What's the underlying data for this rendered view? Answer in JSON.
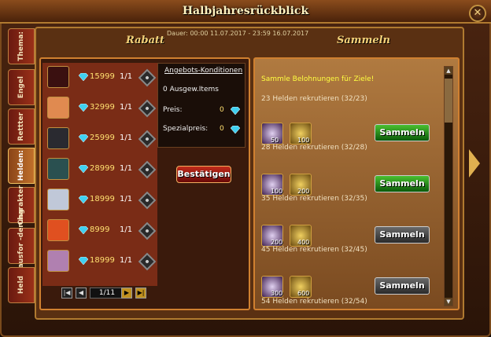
{
  "window": {
    "title": "Halbjahresrückblick",
    "close": "✕"
  },
  "tabs": [
    "Thema:",
    "Engel",
    "Rettter",
    "Helden:",
    "Charakter",
    "Herausfor -derung",
    "Held"
  ],
  "headers": {
    "left": "Rabatt",
    "right": "Sammeln",
    "dauer": "Dauer: 00:00 11.07.2017 - 23:59 16.07.2017"
  },
  "offers": [
    {
      "price": "15999",
      "qty": "1/1",
      "color": "#3a1010"
    },
    {
      "price": "32999",
      "qty": "1/1",
      "color": "#e08a50"
    },
    {
      "price": "25999",
      "qty": "1/1",
      "color": "#2a2a30"
    },
    {
      "price": "28999",
      "qty": "1/1",
      "color": "#2a5050"
    },
    {
      "price": "18999",
      "qty": "1/1",
      "color": "#c0c8d8"
    },
    {
      "price": "8999",
      "qty": "1/1",
      "color": "#e05020"
    },
    {
      "price": "18999",
      "qty": "1/1",
      "color": "#b080b0"
    }
  ],
  "pager": {
    "page": "1/11"
  },
  "conditions": {
    "heading": "Angebots-Konditionen",
    "items": "0 Ausgew.Items",
    "price_label": "Preis:",
    "price_value": "0",
    "special_label": "Spezialpreis:",
    "special_value": "0"
  },
  "confirm": "Bestätigen",
  "collect": {
    "heading": "Sammle Belohnungen für Ziele!",
    "goals": [
      {
        "text": "23 Helden rekrutieren (32/23)",
        "a": "50",
        "b": "100",
        "btn": "Sammeln",
        "state": "green"
      },
      {
        "text": "28 Helden rekrutieren (32/28)",
        "a": "100",
        "b": "200",
        "btn": "Sammeln",
        "state": "green"
      },
      {
        "text": "35 Helden rekrutieren (32/35)",
        "a": "200",
        "b": "400",
        "btn": "Sammeln",
        "state": "gray"
      },
      {
        "text": "45 Helden rekrutieren (32/45)",
        "a": "300",
        "b": "600",
        "btn": "Sammeln",
        "state": "gray"
      }
    ],
    "partial": "54 Helden rekrutieren (32/54)"
  }
}
